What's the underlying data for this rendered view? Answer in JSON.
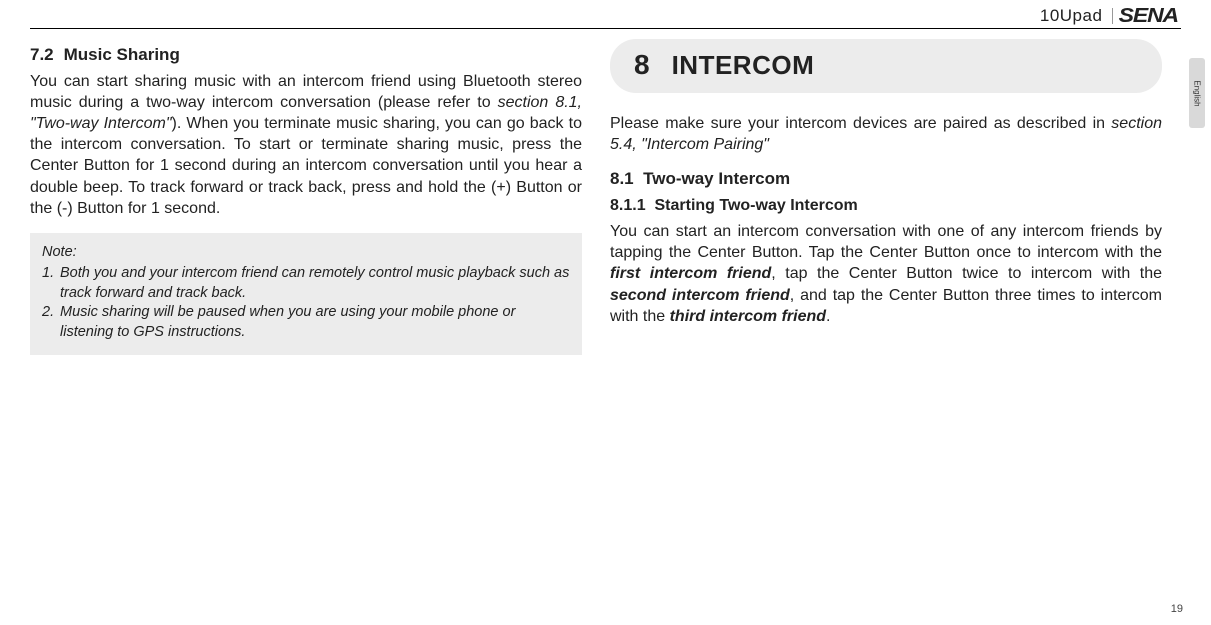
{
  "header": {
    "product": "10Upad",
    "brand": "SENA",
    "language_tab": "English"
  },
  "left": {
    "section_num": "7.2",
    "section_title": "Music Sharing",
    "para_a": "You can start sharing music with an intercom friend using Bluetooth stereo music during a two-way intercom conversation (please refer to ",
    "para_ref": "section 8.1, \"Two-way Intercom\"",
    "para_b": "). When you terminate music sharing, you can go back to the intercom conversation. To start or terminate sharing music, press the Center Button for 1 second during an intercom conversation until you hear a double beep. To track forward or track back, press and hold the (+) Button or the (-) Button for 1 second.",
    "note_title": "Note:",
    "note1_idx": "1.",
    "note1_txt": "Both you and your intercom friend can remotely control music playback such as track forward and track back.",
    "note2_idx": "2.",
    "note2_txt": "Music sharing will be paused when you are using your mobile phone or listening to GPS instructions."
  },
  "right": {
    "chapter_num": "8",
    "chapter_title": "INTERCOM",
    "intro_a": "Please make sure your intercom devices are paired as described in ",
    "intro_ref": "section 5.4, \"Intercom Pairing\"",
    "h81_num": "8.1",
    "h81_title": "Two-way Intercom",
    "h811_num": "8.1.1",
    "h811_title": "Starting Two-way Intercom",
    "p_a": "You can start an intercom conversation with one of any intercom friends by tapping the Center Button. Tap the Center Button once to intercom with the ",
    "p_b1": "first intercom friend",
    "p_c": ", tap the Center Button twice to intercom with the ",
    "p_b2": "second intercom friend",
    "p_d": ", and tap the Center Button three times to intercom with the ",
    "p_b3": "third intercom friend",
    "p_e": "."
  },
  "page_number": "19"
}
